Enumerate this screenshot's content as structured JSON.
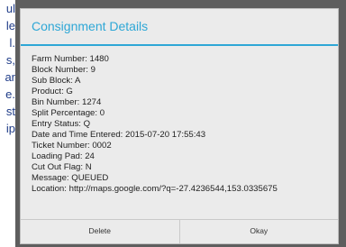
{
  "background_fragments": [
    "ul",
    "le",
    "l.",
    "s,",
    "ar",
    "e.",
    "st",
    "ip"
  ],
  "dialog": {
    "title": "Consignment Details",
    "lines": [
      "Farm Number: 1480",
      "Block Number: 9",
      "Sub Block: A",
      "Product: G",
      "Bin Number: 1274",
      "Split Percentage: 0",
      "Entry Status: Q",
      "Date and Time Entered: 2015-07-20 17:55:43",
      "Ticket Number: 0002",
      "Loading Pad: 24",
      "Cut Out Flag: N",
      "Message: QUEUED",
      "Location: http://maps.google.com/?q=-27.4236544,153.0335675"
    ],
    "buttons": {
      "delete_label": "Delete",
      "okay_label": "Okay"
    }
  },
  "colors": {
    "title": "#2ea7d6",
    "dialog_background": "#ebebeb",
    "frame": "#5e5e5e",
    "background_text": "#1f3c88"
  }
}
